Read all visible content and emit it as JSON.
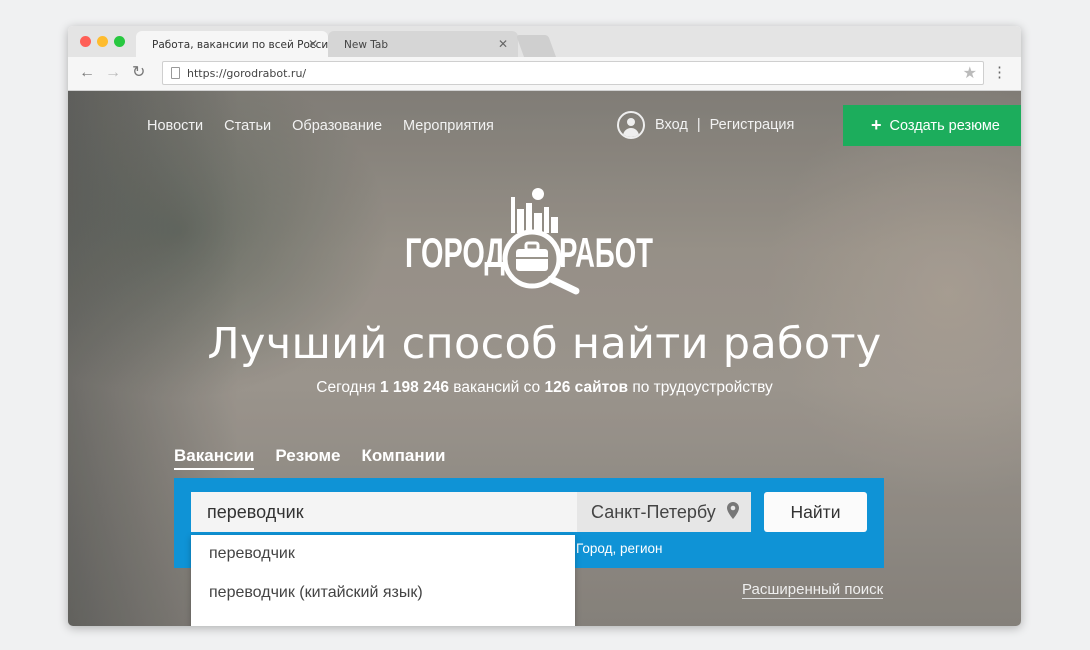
{
  "browser": {
    "tabs": [
      {
        "title": "Работа, вакансии по всей России",
        "close": "✕"
      },
      {
        "title": "New Tab",
        "close": "✕"
      }
    ],
    "url": "https://gorodrabot.ru/",
    "nav": {
      "back": "←",
      "forward": "→",
      "reload": "↻",
      "star": "★",
      "menu": "⋮"
    },
    "lights": [
      "#ff5f57",
      "#febc2e",
      "#28c840"
    ]
  },
  "nav": {
    "items": [
      "Новости",
      "Статьи",
      "Образование",
      "Мероприятия"
    ]
  },
  "auth": {
    "login": "Вход",
    "separator": "|",
    "register": "Регистрация"
  },
  "create_button": {
    "icon": "+",
    "label": "Создать резюме"
  },
  "logo": {
    "left": "ГОРОД",
    "right": "РАБОТ"
  },
  "hero": {
    "headline": "Лучший способ найти работу",
    "sub_prefix": "Сегодня",
    "vacancies": "1 198 246",
    "sub_middle": "вакансий со",
    "sites": "126 сайтов",
    "sub_suffix": "по трудоустройству"
  },
  "search": {
    "tabs": [
      "Вакансии",
      "Резюме",
      "Компании"
    ],
    "query": "переводчик",
    "city": "Санкт-Петербу",
    "city_hint": "Город, регион",
    "find_label": "Найти",
    "suggestions": [
      "переводчик",
      "переводчик (китайский язык)"
    ],
    "advanced": "Расширенный поиск"
  },
  "colors": {
    "accent_green": "#1cad5c",
    "search_blue": "#0f93d6"
  }
}
